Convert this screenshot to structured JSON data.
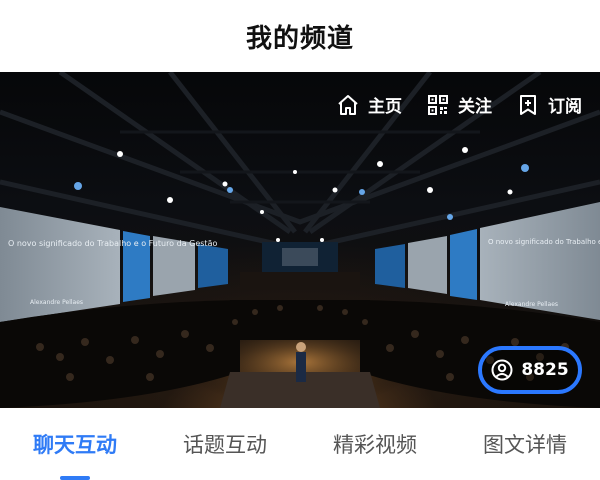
{
  "header": {
    "title": "我的频道"
  },
  "hero": {
    "actions": [
      {
        "icon": "home-icon",
        "label": "主页"
      },
      {
        "icon": "qr-code-icon",
        "label": "关注"
      },
      {
        "icon": "subscribe-icon",
        "label": "订阅"
      }
    ],
    "viewer_count": "8825",
    "viewer_icon": "user-icon",
    "screen_texts": {
      "left_title": "O novo significado do Trabalho e o Futuro da Gestão",
      "left_name": "Alexandre Pellaes",
      "right_title": "O novo significado do Trabalho e o Futuro da Gestão",
      "right_name": "Alexandre Pellaes"
    }
  },
  "tabs": [
    {
      "label": "聊天互动",
      "active": true
    },
    {
      "label": "话题互动",
      "active": false
    },
    {
      "label": "精彩视频",
      "active": false
    },
    {
      "label": "图文详情",
      "active": false
    }
  ],
  "colors": {
    "accent": "#2f7bf6",
    "badge_border": "#2b78ff",
    "header_bg": "#ffffff",
    "title_text": "#111111"
  }
}
